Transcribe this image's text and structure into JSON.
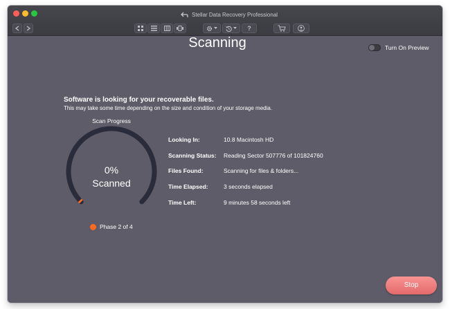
{
  "window": {
    "title": "Stellar Data Recovery Professional"
  },
  "toolbar": {
    "icons": [
      "back-arrow-icon",
      "forward-arrow-icon",
      "grid-view-icon",
      "list-view-icon",
      "column-view-icon",
      "cover-flow-icon",
      "gear-icon",
      "history-icon",
      "help-icon",
      "cart-icon",
      "account-icon"
    ],
    "help_label": "?"
  },
  "header": {
    "title": "Scanning",
    "preview_toggle_label": "Turn On Preview",
    "preview_enabled": false
  },
  "scan": {
    "headline": "Software is looking for your recoverable files.",
    "subline": "This may take some time depending on the size and condition of your storage media.",
    "progress_title": "Scan Progress",
    "percent": "0%",
    "percent_label": "Scanned",
    "progress_fraction": 0.0,
    "phase": "Phase 2 of 4",
    "accent_color": "#ff6a1e"
  },
  "details": {
    "looking_in_label": "Looking In:",
    "looking_in_value": "10.8 Macintosh HD",
    "status_label": "Scanning Status:",
    "status_value": "Reading Sector 507776 of 101824760",
    "files_found_label": "Files Found:",
    "files_found_value": "Scanning for files & folders...",
    "elapsed_label": "Time Elapsed:",
    "elapsed_value": "3 seconds elapsed",
    "left_label": "Time Left:",
    "left_value": "9 minutes 58 seconds left"
  },
  "actions": {
    "stop_label": "Stop"
  }
}
